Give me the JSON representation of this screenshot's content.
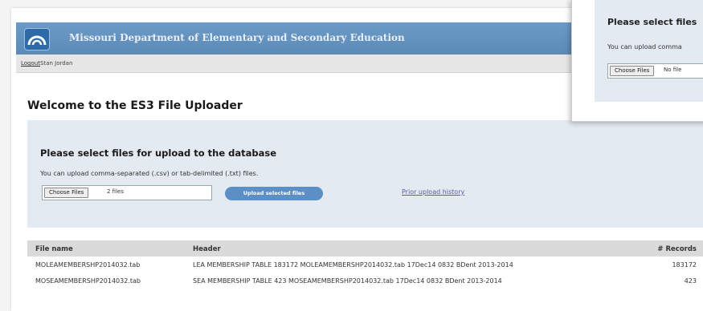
{
  "header": {
    "title": "Missouri Department of Elementary and Secondary Education",
    "logout": "Logout",
    "user": "Stan Jordan"
  },
  "page_title": "Welcome to the ES3 File Uploader",
  "upload": {
    "heading": "Please select files for upload to the database",
    "description": "You can upload comma-separated (.csv) or tab-delimited (.txt) files.",
    "choose_label": "Choose Files",
    "file_status": "2 files",
    "upload_label": "Upload selected files",
    "prior_link": "Prior upload history"
  },
  "table": {
    "columns": [
      "File name",
      "Header",
      "# Records"
    ],
    "rows": [
      [
        "MOLEAMEMBERSHP2014032.tab",
        "LEA MEMBERSHIP TABLE 183172 MOLEAMEMBERSHP2014032.tab 17Dec14 0832 BDent 2013-2014",
        "183172"
      ],
      [
        "MOSEAMEMBERSHP2014032.tab",
        "SEA MEMBERSHIP TABLE 423 MOSEAMEMBERSHP2014032.tab 17Dec14 0832 BDent 2013-2014",
        "423"
      ]
    ]
  },
  "popup": {
    "heading": "Please select files",
    "description": "You can upload comma",
    "choose_label": "Choose Files",
    "file_status": "No file"
  }
}
